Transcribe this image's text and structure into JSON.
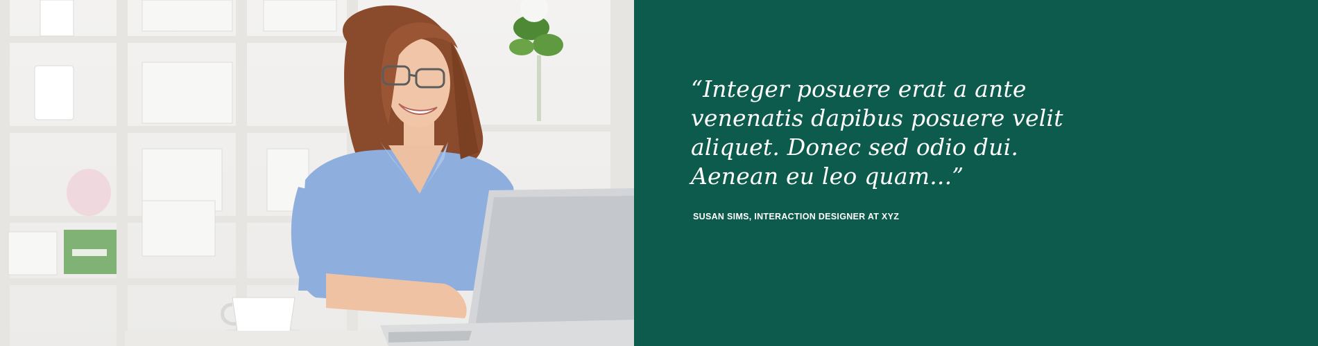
{
  "photo": {
    "alt": "Smiling woman with glasses working on a laptop in a bright office"
  },
  "testimonial": {
    "quote": "“Integer posuere erat a ante venenatis dapibus posuere velit aliquet. Donec sed odio dui. Aenean eu leo quam...”",
    "author": "SUSAN SIMS, INTERACTION DESIGNER AT XYZ"
  },
  "colors": {
    "panel_background": "#0c5b4d",
    "quote_text": "#ffffff"
  }
}
